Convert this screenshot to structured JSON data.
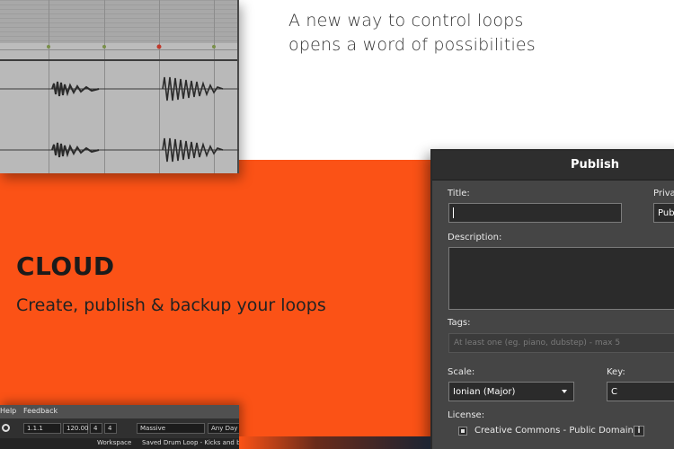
{
  "hero": {
    "tagline_line1": "A new way to control loops",
    "tagline_line2": "opens a word of possibilities",
    "cloud_title": "CLOUD",
    "cloud_subtitle": "Create, publish & backup your loops"
  },
  "colors": {
    "accent_orange": "#fb5216",
    "dialog_bg": "#454545",
    "dialog_titlebar": "#2e2e2e"
  },
  "publish_dialog": {
    "title": "Publish",
    "title_label": "Title:",
    "title_value": "",
    "privacy_label": "Privac",
    "privacy_value": "Pub",
    "description_label": "Description:",
    "tags_label": "Tags:",
    "tags_placeholder": "At least one (eg. piano, dubstep) - max 5",
    "scale_label": "Scale:",
    "scale_value": "Ionian (Major)",
    "key_label": "Key:",
    "key_value": "C",
    "license_label": "License:",
    "license_value": "Creative Commons - Public Domain",
    "info_icon_glyph": "i"
  },
  "daw": {
    "menu_items": [
      "Help",
      "Feedback"
    ],
    "position": "1.1.1",
    "tempo": "120.00",
    "time_sig_num": "4",
    "time_sig_den": "4",
    "instrument": "Massive",
    "key_filter": "Any Day",
    "workspace_label": "Workspace",
    "status_text": "Saved Drum Loop - Kicks and ba"
  }
}
